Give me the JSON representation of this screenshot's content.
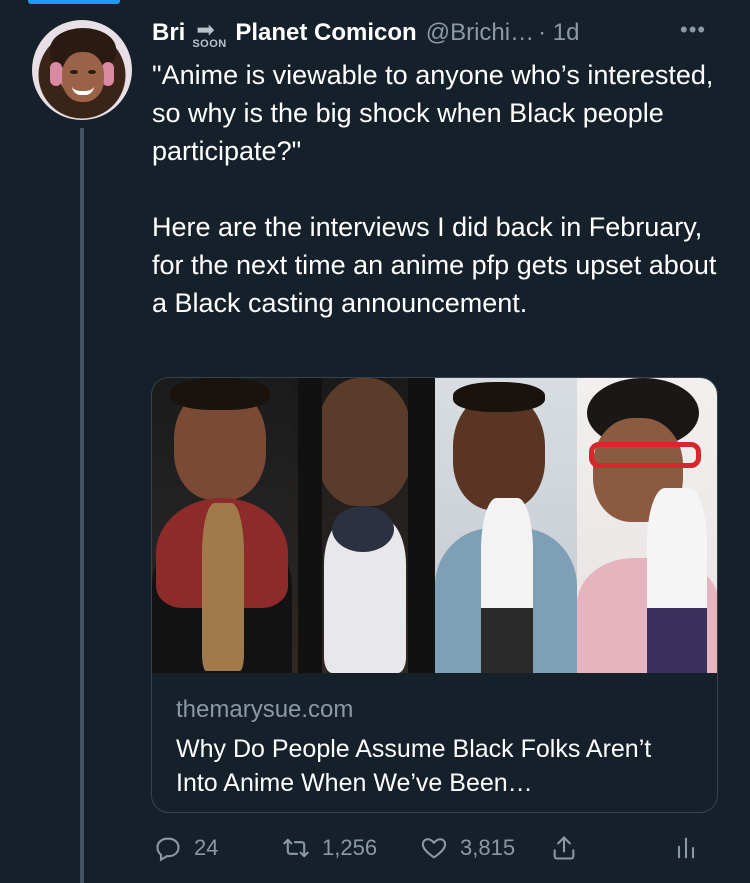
{
  "tweet": {
    "display_name": "Bri",
    "emoji_text": "SOON",
    "display_name_suffix": "Planet Comicon",
    "handle": "@Brichi…",
    "time": "· 1d",
    "text": "\"Anime is viewable to anyone who’s interested, so why is the big shock when Black people participate?\"\n\nHere are the interviews I did back in February, for the next time an anime pfp gets upset about a Black casting announcement."
  },
  "card": {
    "domain": "themarysue.com",
    "title": "Why Do People Assume Black Folks Aren’t Into Anime When We’ve Been…"
  },
  "actions": {
    "reply_count": "24",
    "retweet_count": "1,256",
    "like_count": "3,815"
  },
  "colors": {
    "background": "#15202b",
    "accent": "#1d9bf0",
    "muted_text": "#8b98a5",
    "border": "#38444d"
  },
  "icons": [
    "more-icon",
    "reply-icon",
    "retweet-icon",
    "like-icon",
    "share-icon",
    "stats-icon"
  ]
}
